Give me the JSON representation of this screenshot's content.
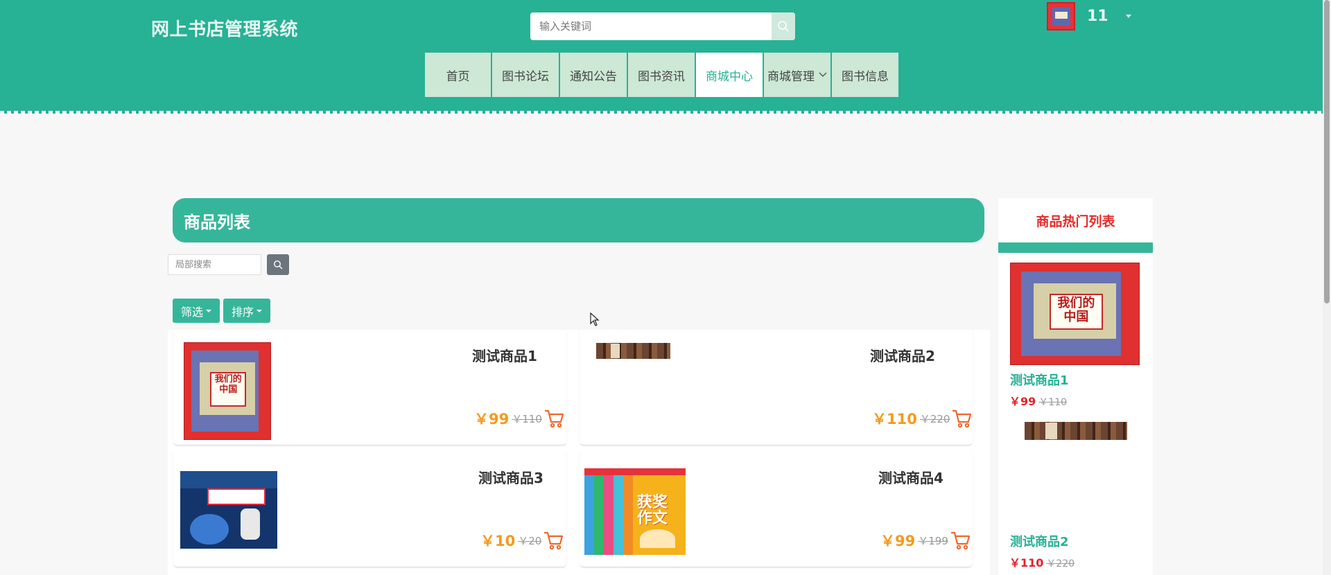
{
  "header": {
    "site_title": "网上书店管理系统",
    "search_placeholder": "输入关键词",
    "user_count": "11"
  },
  "nav": [
    {
      "label": "首页",
      "active": false
    },
    {
      "label": "图书论坛",
      "active": false
    },
    {
      "label": "通知公告",
      "active": false
    },
    {
      "label": "图书资讯",
      "active": false
    },
    {
      "label": "商城中心",
      "active": true
    },
    {
      "label": "商城管理",
      "active": false,
      "dropdown": true
    },
    {
      "label": "图书信息",
      "active": false
    }
  ],
  "main": {
    "list_title": "商品列表",
    "local_search_placeholder": "局部搜索",
    "filter_label": "筛选",
    "sort_label": "排序"
  },
  "products": [
    {
      "name": "测试商品1",
      "price": "￥99",
      "old_price": "￥110",
      "cover": "china"
    },
    {
      "name": "测试商品2",
      "price": "￥110",
      "old_price": "￥220",
      "cover": "dark"
    },
    {
      "name": "测试商品3",
      "price": "￥10",
      "old_price": "￥20",
      "cover": "space"
    },
    {
      "name": "测试商品4",
      "price": "￥99",
      "old_price": "￥199",
      "cover": "yellow"
    }
  ],
  "sidebar": {
    "title": "商品热门列表",
    "items": [
      {
        "name": "测试商品1",
        "price": "￥99",
        "old_price": "￥110"
      },
      {
        "name": "测试商品2",
        "price": "￥110",
        "old_price": "￥220"
      }
    ]
  },
  "colors": {
    "brand": "#27b195",
    "price_orange": "#f39a1e",
    "price_red": "#e6212a",
    "nav_bg": "#cde8d5"
  },
  "icons": [
    "search-icon",
    "cart-icon",
    "chevron-down-icon",
    "caret-down-icon"
  ]
}
